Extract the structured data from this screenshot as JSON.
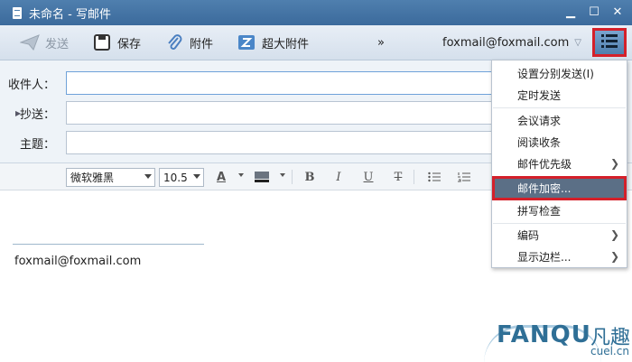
{
  "window": {
    "title": "未命名 - 写邮件"
  },
  "toolbar": {
    "send_label": "发送",
    "save_label": "保存",
    "attach_label": "附件",
    "bigattach_label": "超大附件",
    "more_label": "»",
    "account": "foxmail@foxmail.com"
  },
  "header": {
    "to_label": "收件人：",
    "cc_label": "抄送：",
    "subject_label": "主题：",
    "to_value": "",
    "cc_value": "",
    "subject_value": ""
  },
  "format": {
    "font": "微软雅黑",
    "size": "10.5"
  },
  "body": {
    "signature": "foxmail@foxmail.com"
  },
  "menu": {
    "items": [
      {
        "label": "设置分别发送(I)"
      },
      {
        "label": "定时发送"
      },
      {
        "label": "会议请求"
      },
      {
        "label": "阅读收条"
      },
      {
        "label": "邮件优先级"
      },
      {
        "label": "邮件加密..."
      },
      {
        "label": "拼写检查"
      },
      {
        "label": "编码"
      },
      {
        "label": "显示边栏..."
      }
    ]
  },
  "watermark": {
    "brand": "FANQU",
    "brand_cn": "凡趣",
    "url": "cuel.cn"
  },
  "colors": {
    "titlebar": "#4f7fae",
    "highlight": "#d4202a",
    "menu_selected": "#5b6f86"
  }
}
